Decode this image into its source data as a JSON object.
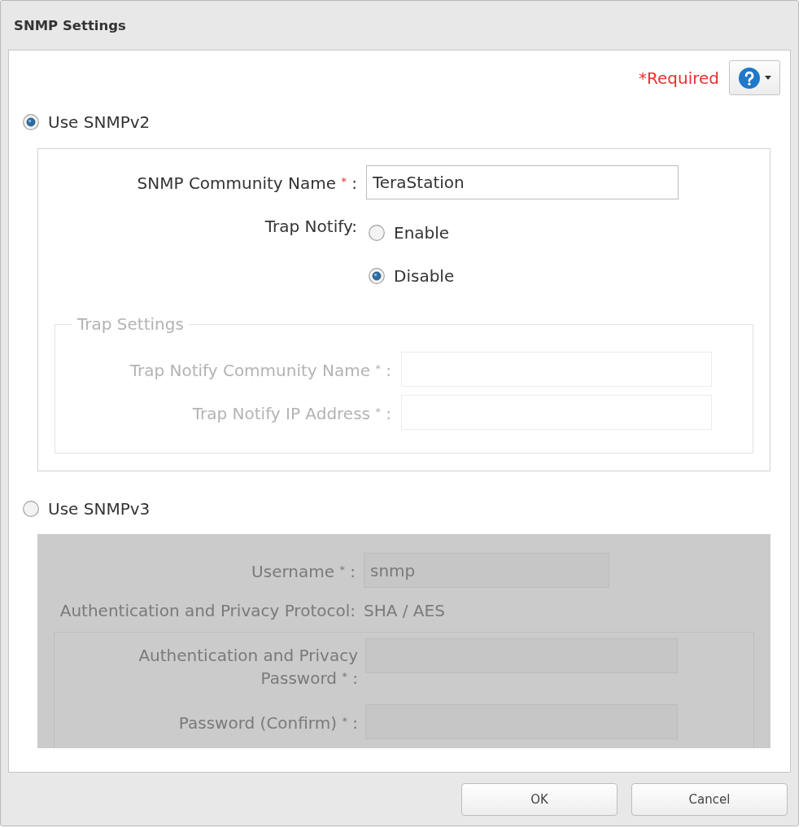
{
  "window": {
    "title": "SNMP Settings"
  },
  "header": {
    "required_note": "*Required"
  },
  "snmpv2": {
    "option": {
      "label": "Use SNMPv2",
      "selected": true
    },
    "community_name": {
      "label": "SNMP Community Name",
      "required_mark": "*",
      "suffix": ":",
      "value": "TeraStation"
    },
    "trap_notify": {
      "label": "Trap Notify:",
      "options": [
        {
          "label": "Enable",
          "selected": false
        },
        {
          "label": "Disable",
          "selected": true
        }
      ]
    },
    "trap_settings": {
      "legend": "Trap Settings",
      "disabled": true,
      "fields": [
        {
          "label": "Trap Notify Community Name",
          "required_mark": "*",
          "suffix": ":"
        },
        {
          "label": "Trap Notify IP Address",
          "required_mark": "*",
          "suffix": ":"
        }
      ]
    }
  },
  "snmpv3": {
    "option": {
      "label": "Use SNMPv3",
      "selected": false
    },
    "disabled": true,
    "username": {
      "label": "Username",
      "required_mark": "*",
      "suffix": ":",
      "value": "snmp"
    },
    "protocol": {
      "label": "Authentication and Privacy Protocol:",
      "value": "SHA / AES"
    },
    "password_fields": [
      {
        "label": "Authentication and Privacy Password",
        "required_mark": "*",
        "suffix": ":"
      },
      {
        "label": "Password (Confirm)",
        "required_mark": "*",
        "suffix": ":"
      }
    ]
  },
  "footer": {
    "buttons": [
      "OK",
      "Cancel"
    ]
  }
}
